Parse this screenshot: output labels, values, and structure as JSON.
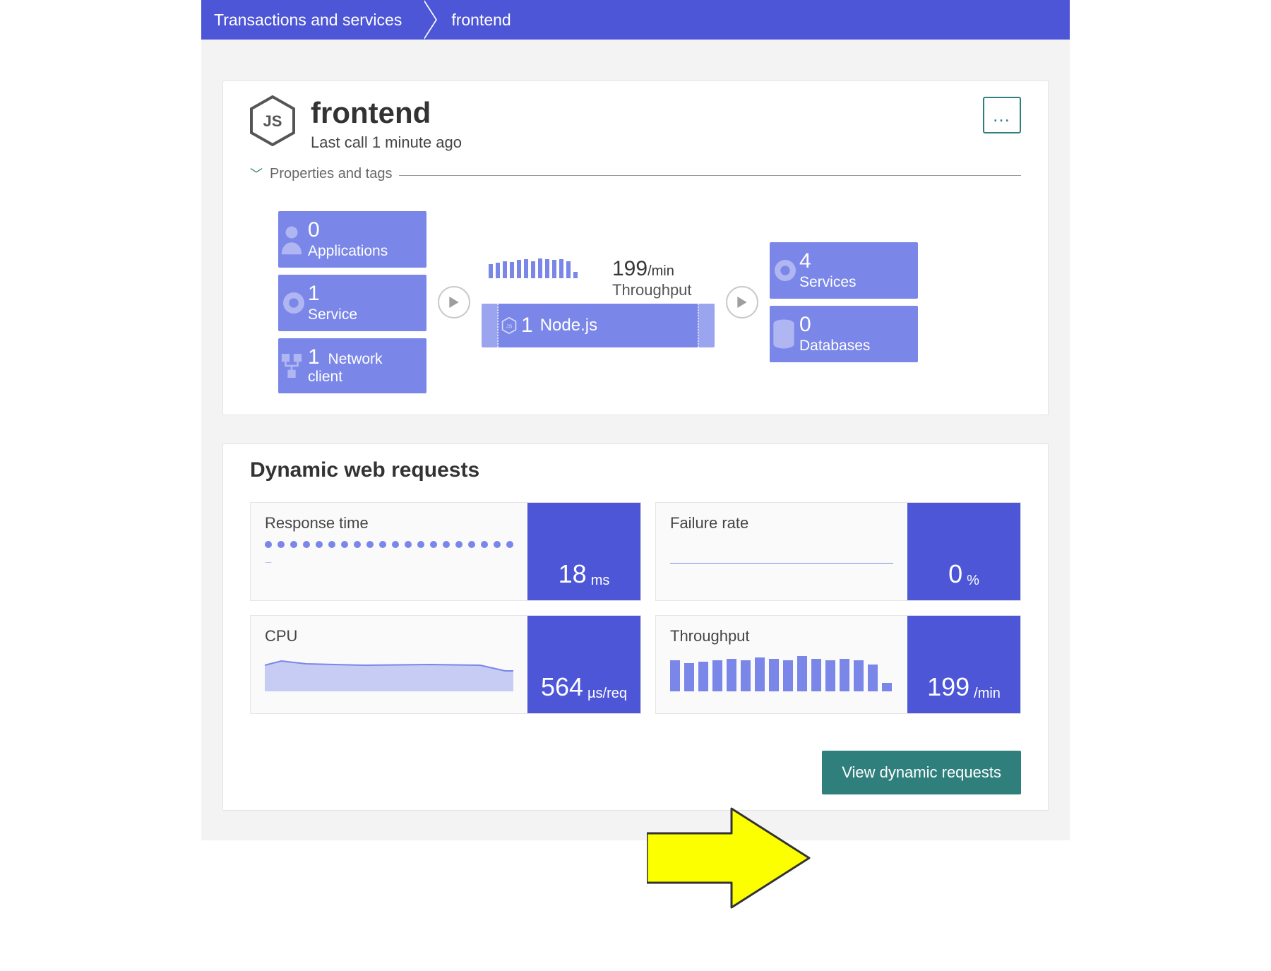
{
  "breadcrumb": {
    "root": "Transactions and services",
    "leaf": "frontend"
  },
  "header": {
    "title": "frontend",
    "subtitle": "Last call 1 minute ago",
    "props_label": "Properties and tags"
  },
  "flow": {
    "left": [
      {
        "count": "0",
        "label": "Applications",
        "icon": "user"
      },
      {
        "count": "1",
        "label": "Service",
        "icon": "gear"
      },
      {
        "count": "1",
        "label": "Network client",
        "icon": "net",
        "single": true
      }
    ],
    "center": {
      "throughput_value": "199",
      "throughput_unit": "/min",
      "throughput_label": "Throughput",
      "node_count": "1",
      "node_label": "Node.js",
      "spark": [
        18,
        20,
        22,
        21,
        23,
        24,
        22,
        25,
        24,
        23,
        24,
        22,
        8
      ]
    },
    "right": [
      {
        "count": "4",
        "label": "Services",
        "icon": "gear"
      },
      {
        "count": "0",
        "label": "Databases",
        "icon": "db"
      }
    ]
  },
  "metrics": {
    "title": "Dynamic web requests",
    "cards": {
      "response": {
        "label": "Response time",
        "value": "18",
        "unit": "ms"
      },
      "failure": {
        "label": "Failure rate",
        "value": "0",
        "unit": "%"
      },
      "cpu": {
        "label": "CPU",
        "value": "564",
        "unit": "µs/req"
      },
      "thru": {
        "label": "Throughput",
        "value": "199",
        "unit": "/min"
      }
    },
    "button": "View dynamic requests"
  },
  "chart_data": [
    {
      "type": "bar",
      "name": "header-throughput-spark",
      "values": [
        18,
        20,
        22,
        21,
        23,
        24,
        22,
        25,
        24,
        23,
        24,
        22,
        8
      ]
    },
    {
      "type": "line",
      "name": "response-time-spark",
      "values": [
        18,
        18,
        18,
        18,
        18,
        18,
        18,
        18,
        18,
        18,
        18,
        18,
        18,
        18,
        18,
        18,
        18,
        18,
        18,
        18
      ],
      "ylabel": "ms"
    },
    {
      "type": "line",
      "name": "failure-rate-spark",
      "values": [
        0,
        0,
        0,
        0,
        0,
        0,
        0,
        0,
        0,
        0
      ],
      "ylabel": "%"
    },
    {
      "type": "area",
      "name": "cpu-spark",
      "values": [
        560,
        590,
        570,
        565,
        560,
        558,
        560,
        562,
        560,
        558,
        560,
        520
      ],
      "ylabel": "µs/req"
    },
    {
      "type": "bar",
      "name": "throughput-spark",
      "values": [
        44,
        40,
        42,
        44,
        46,
        44,
        48,
        46,
        44,
        50,
        46,
        44,
        46,
        44,
        38,
        12
      ],
      "ylabel": "/min"
    }
  ]
}
